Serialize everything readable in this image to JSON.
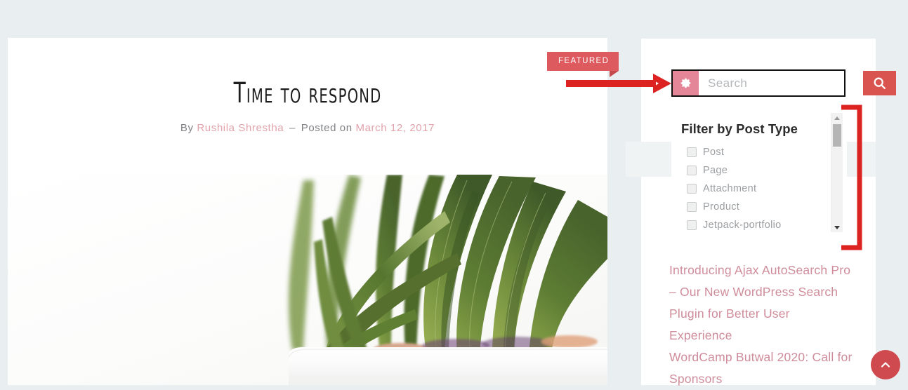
{
  "theme": {
    "page_background": "#e9eef0",
    "accent_red": "#d9534f",
    "accent_pink": "#e48598",
    "link_pink": "#cf8c9a",
    "annotation_red": "#dd2222"
  },
  "article": {
    "featured_badge": "FEATURED",
    "title": "Time to respond",
    "meta": {
      "by_label": "By",
      "author": "Rushila Shrestha",
      "separator": "–",
      "posted_label": "Posted on",
      "date": "March 12, 2017"
    },
    "photo_alt": "succulent plant in a white pot"
  },
  "sidebar": {
    "search": {
      "placeholder": "Search",
      "value": "",
      "gear_icon": "gear-icon",
      "submit_icon": "search-icon"
    },
    "filter": {
      "heading": "Filter by Post Type",
      "options": [
        {
          "label": "Post",
          "checked": false
        },
        {
          "label": "Page",
          "checked": false
        },
        {
          "label": "Attachment",
          "checked": false
        },
        {
          "label": "Product",
          "checked": false
        },
        {
          "label": "Jetpack-portfolio",
          "checked": false
        }
      ],
      "scrollbar": {
        "up_icon": "triangle-up-icon",
        "down_icon": "triangle-down-icon"
      }
    },
    "recent_posts": [
      "Introducing Ajax AutoSearch Pro – Our New WordPress Search Plugin for Better User Experience",
      "WordCamp Butwal 2020: Call for Sponsors"
    ]
  },
  "back_to_top": {
    "icon": "chevron-up-icon"
  },
  "annotations": {
    "arrow": "red-arrow-pointing-to-search-box",
    "box": "black-rectangle-around-search-box",
    "bracket": "red-bracket-around-filter-scrollbar"
  }
}
